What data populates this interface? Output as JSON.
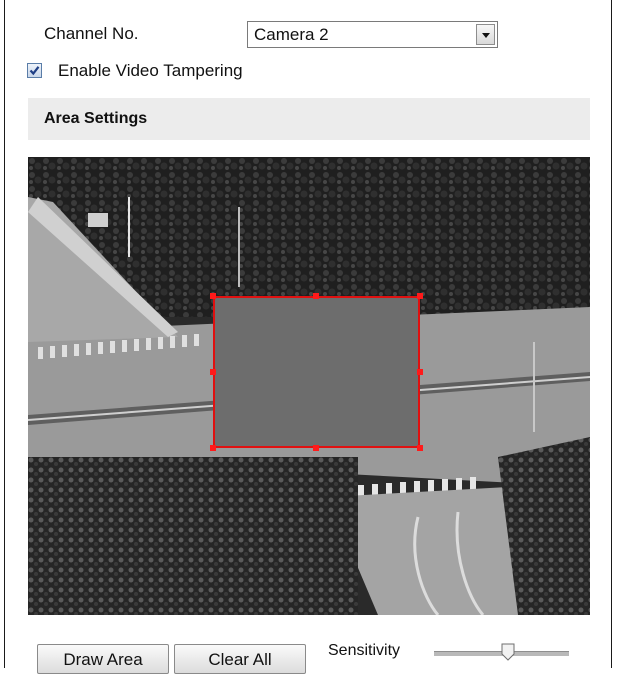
{
  "channel": {
    "label": "Channel No.",
    "selected": "Camera 2"
  },
  "tampering": {
    "label": "Enable Video Tampering",
    "checked": true
  },
  "area": {
    "title": "Area Settings"
  },
  "buttons": {
    "draw": "Draw Area",
    "clear": "Clear All"
  },
  "sensitivity": {
    "label": "Sensitivity",
    "level_percent": 55
  },
  "colors": {
    "area_border": "#e01010",
    "area_fill": "#6d6d6d",
    "header_bg": "#ececec"
  }
}
